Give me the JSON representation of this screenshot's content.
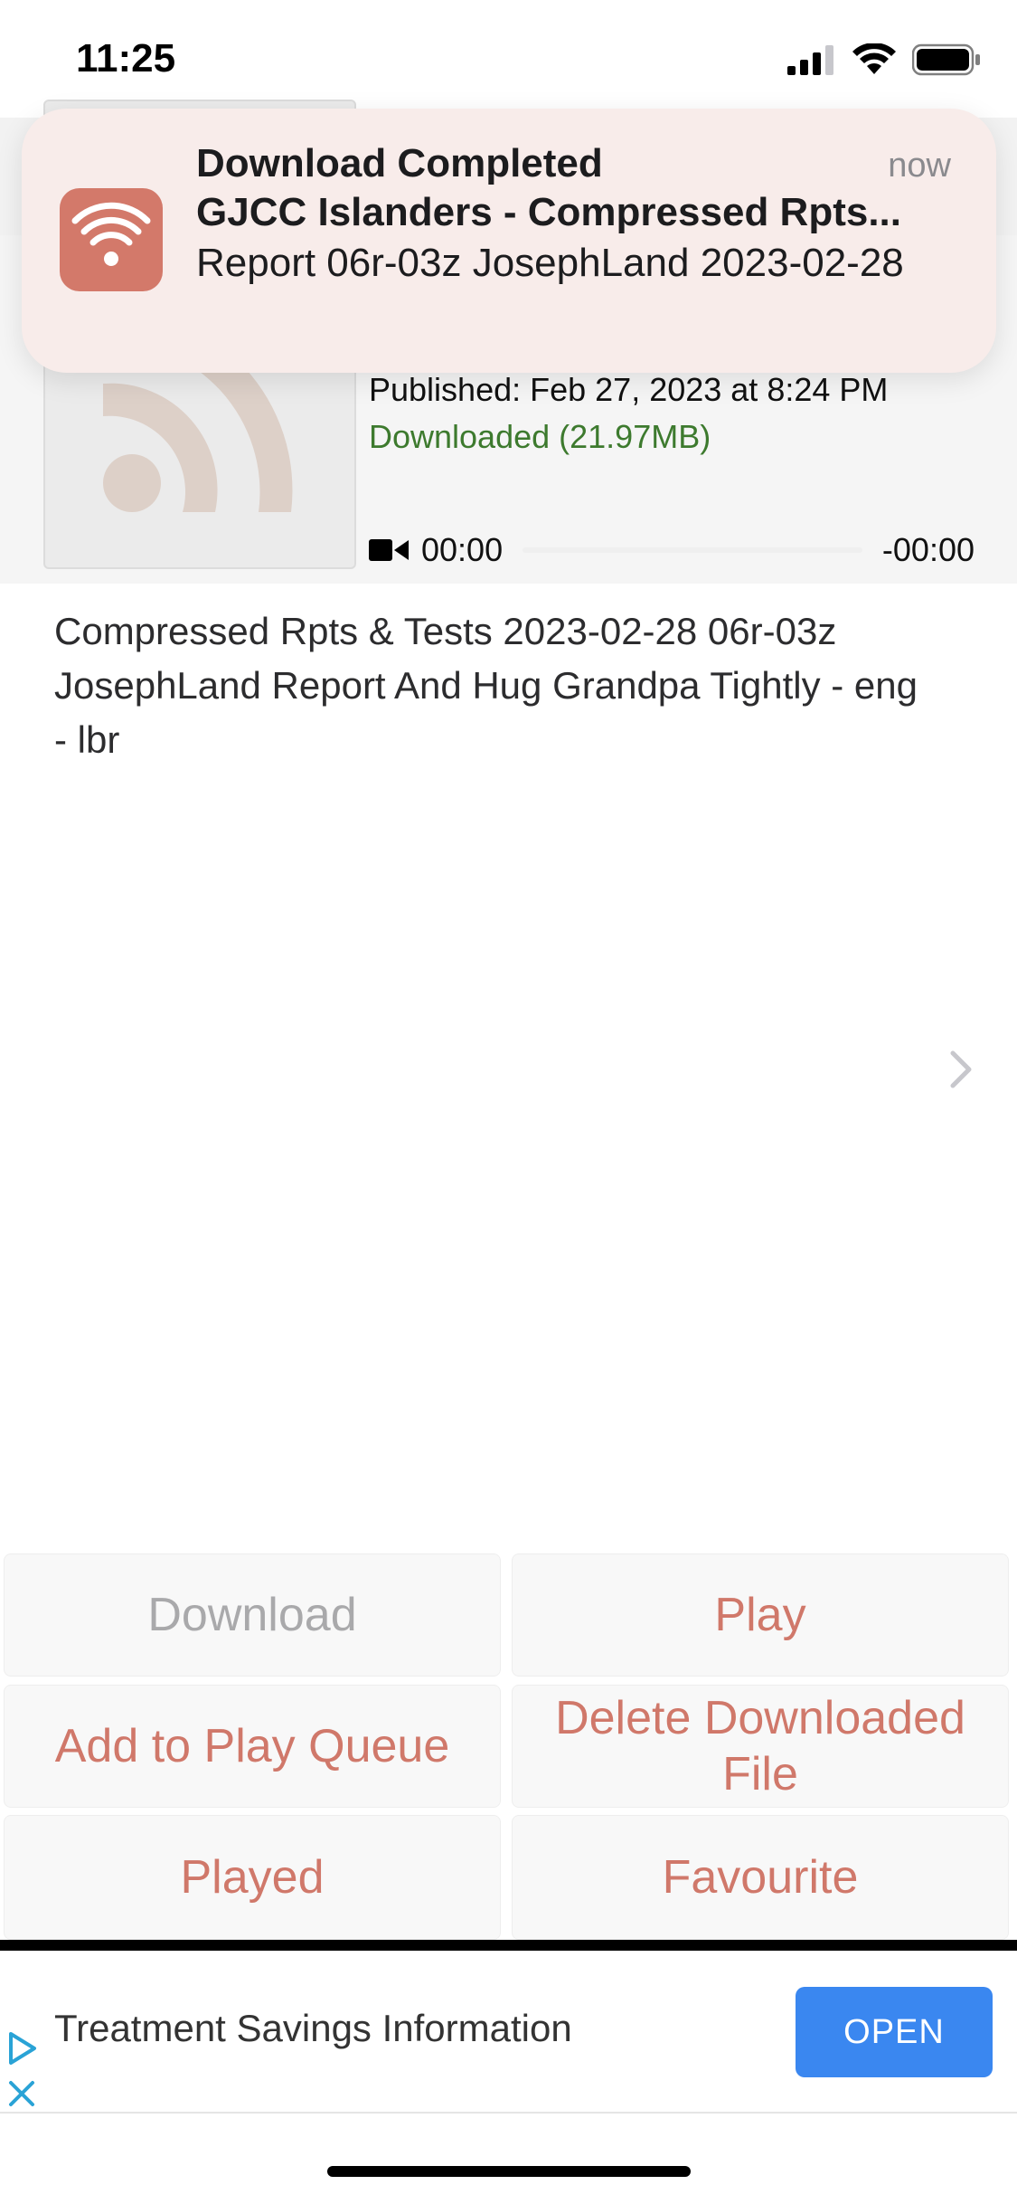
{
  "status_bar": {
    "time": "11:25"
  },
  "notification": {
    "title": "Download Completed",
    "subtitle": "GJCC Islanders - Compressed Rpts...",
    "body": "Report 06r-03z JosephLand 2023-02-28",
    "time": "now",
    "icon": "podcast-wifi-icon"
  },
  "episode": {
    "published": "Published: Feb 27, 2023 at 8:24 PM",
    "downloaded": "Downloaded (21.97MB)",
    "player": {
      "elapsed": "00:00",
      "remaining": "-00:00",
      "progress": 0
    },
    "description": "Compressed Rpts & Tests 2023-02-28 06r-03z JosephLand Report And Hug Grandpa Tightly - eng - lbr"
  },
  "actions": {
    "download": "Download",
    "play": "Play",
    "add_to_queue": "Add to Play Queue",
    "delete_downloaded": "Delete Downloaded File",
    "played": "Played",
    "favourite": "Favourite"
  },
  "ad": {
    "text": "Treatment Savings Information",
    "open": "OPEN"
  },
  "colors": {
    "accent": "#d0786a",
    "downloaded_green": "#3d7a2e",
    "ad_button": "#3a87f0"
  }
}
